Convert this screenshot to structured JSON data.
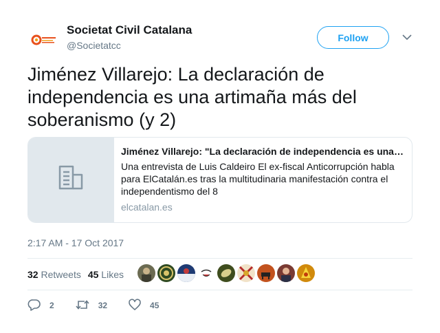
{
  "account": {
    "name": "Societat Civil Catalana",
    "handle": "@Societatcc",
    "follow_label": "Follow"
  },
  "tweet": {
    "text": "Jiménez Villarejo: La declaración de independencia es una artimaña más del soberanismo (y 2)",
    "timestamp": "2:17 AM - 17 Oct 2017"
  },
  "card": {
    "title": "Jiménez Villarejo: \"La declaración de independencia es una artimaña más del soberanismo\"",
    "description": "Una entrevista de Luis Caldeiro El ex-fiscal Anticorrupción habla para ElCatalán.es tras la multitudinaria manifestación contra el independentismo del 8",
    "domain": "elcatalan.es",
    "thumb_icon": "document-icon"
  },
  "stats": {
    "retweets_count": "32",
    "retweets_label": "Retweets",
    "likes_count": "45",
    "likes_label": "Likes"
  },
  "actions": {
    "reply_count": "2",
    "retweet_count": "32",
    "like_count": "45"
  },
  "colors": {
    "accent": "#1da1f2",
    "muted": "#657786",
    "border": "#e1e8ed"
  }
}
